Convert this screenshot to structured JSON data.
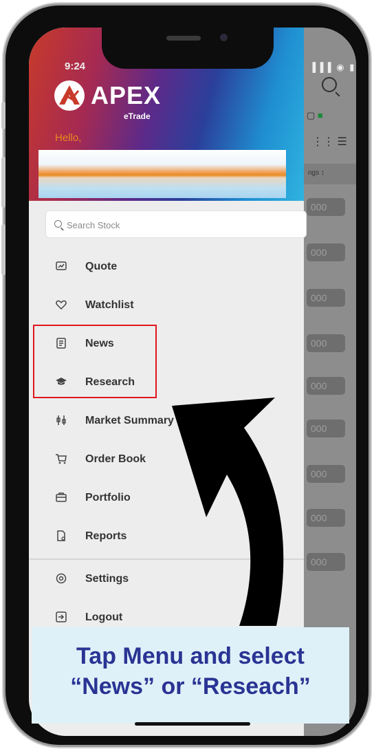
{
  "status": {
    "time": "9:24",
    "icons": "▐▐▐ ◉ ▮"
  },
  "brand": {
    "name": "APEX",
    "sub": "eTrade",
    "greeting": "Hello,"
  },
  "search": {
    "placeholder": "Search Stock"
  },
  "menu": [
    {
      "label": "Quote",
      "icon": "chart-icon"
    },
    {
      "label": "Watchlist",
      "icon": "heart-icon"
    },
    {
      "label": "News",
      "icon": "news-icon"
    },
    {
      "label": "Research",
      "icon": "graduation-cap-icon"
    },
    {
      "label": "Market Summary",
      "icon": "scale-icon"
    },
    {
      "label": "Order Book",
      "icon": "cart-icon"
    },
    {
      "label": "Portfolio",
      "icon": "briefcase-icon"
    },
    {
      "label": "Reports",
      "icon": "document-icon"
    },
    {
      "label": "Settings",
      "icon": "gear-icon"
    },
    {
      "label": "Logout",
      "icon": "logout-icon"
    }
  ],
  "background": {
    "column_header": "ngs ↕",
    "values": [
      "000",
      "000",
      "000",
      "000",
      "000",
      "000",
      "000",
      "000",
      "000"
    ]
  },
  "caption": {
    "line1": "Tap Menu and select",
    "line2": "“News” or “Reseach”"
  },
  "colors": {
    "highlight": "#e0161b",
    "caption_text": "#2a3494",
    "caption_bg": "#dff1f8",
    "greeting": "#e88a20"
  }
}
